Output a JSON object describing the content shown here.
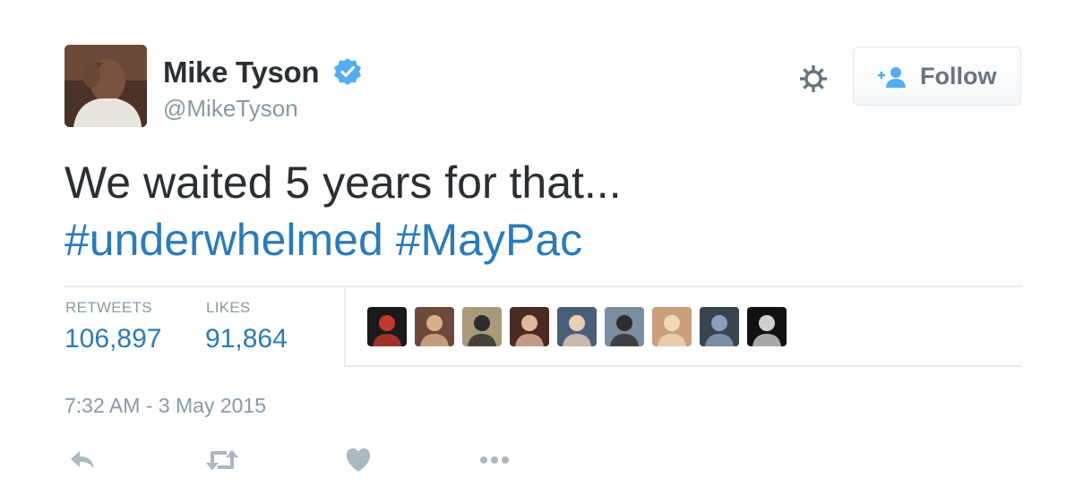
{
  "user": {
    "display_name": "Mike Tyson",
    "handle": "@MikeTyson",
    "verified": true
  },
  "header": {
    "follow_label": "Follow",
    "settings_icon": "gear-icon",
    "follow_icon": "add-user-icon"
  },
  "tweet": {
    "text": "We waited 5 years for that...",
    "hashtags": [
      "#underwhelmed",
      "#MayPac"
    ],
    "timestamp": "7:32 AM - 3 May 2015"
  },
  "stats": {
    "retweets_label": "RETWEETS",
    "retweets_value": "106,897",
    "likes_label": "LIKES",
    "likes_value": "91,864"
  },
  "likers": [
    {
      "name": "liker-avatar-1",
      "bg": "#1a1a1a",
      "fg": "#c0392b"
    },
    {
      "name": "liker-avatar-2",
      "bg": "#6b4a3a",
      "fg": "#d9b08c"
    },
    {
      "name": "liker-avatar-3",
      "bg": "#a89a7a",
      "fg": "#2c2c2c"
    },
    {
      "name": "liker-avatar-4",
      "bg": "#4a2c24",
      "fg": "#e0b8a0"
    },
    {
      "name": "liker-avatar-5",
      "bg": "#4a5e78",
      "fg": "#e8d0b8"
    },
    {
      "name": "liker-avatar-6",
      "bg": "#7a8ea0",
      "fg": "#2e2e2e"
    },
    {
      "name": "liker-avatar-7",
      "bg": "#c9a07a",
      "fg": "#f0d8b8"
    },
    {
      "name": "liker-avatar-8",
      "bg": "#3a4450",
      "fg": "#8aa0b8"
    },
    {
      "name": "liker-avatar-9",
      "bg": "#111111",
      "fg": "#cfcfcf"
    }
  ],
  "actions": [
    {
      "name": "reply-icon"
    },
    {
      "name": "retweet-icon"
    },
    {
      "name": "like-icon"
    },
    {
      "name": "more-icon"
    }
  ],
  "colors": {
    "link": "#2b7bb9",
    "text": "#292f33",
    "muted": "#8899a6",
    "verified": "#55acee"
  }
}
